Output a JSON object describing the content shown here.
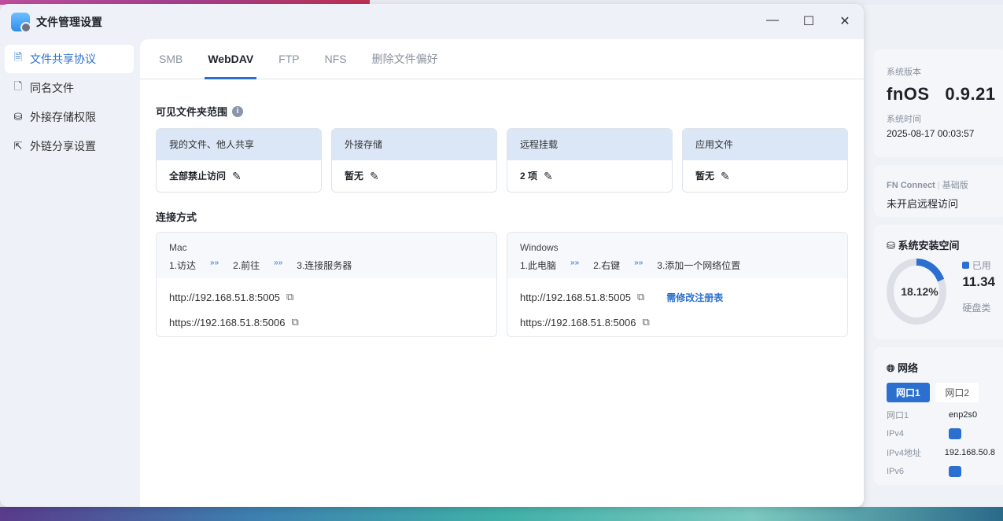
{
  "window": {
    "title": "文件管理设置",
    "minimize": "—",
    "maximize": "☐",
    "close": "✕"
  },
  "sidebar": {
    "items": [
      {
        "label": "文件共享协议",
        "icon": "document-icon"
      },
      {
        "label": "同名文件",
        "icon": "file-icon"
      },
      {
        "label": "外接存储权限",
        "icon": "drive-icon"
      },
      {
        "label": "外链分享设置",
        "icon": "share-icon"
      }
    ]
  },
  "tabs": [
    "SMB",
    "WebDAV",
    "FTP",
    "NFS",
    "删除文件偏好"
  ],
  "active_tab": "WebDAV",
  "scope": {
    "title": "可见文件夹范围",
    "cards": [
      {
        "head": "我的文件、他人共享",
        "value": "全部禁止访问"
      },
      {
        "head": "外接存储",
        "value": "暂无"
      },
      {
        "head": "远程挂载",
        "value": "2 项"
      },
      {
        "head": "应用文件",
        "value": "暂无"
      }
    ]
  },
  "connection": {
    "title": "连接方式",
    "mac": {
      "os": "Mac",
      "steps": [
        "1.访达",
        "2.前往",
        "3.连接服务器"
      ],
      "http": "http://192.168.51.8:5005",
      "https": "https://192.168.51.8:5006"
    },
    "windows": {
      "os": "Windows",
      "steps": [
        "1.此电脑",
        "2.右键",
        "3.添加一个网络位置"
      ],
      "http": "http://192.168.51.8:5005",
      "https": "https://192.168.51.8:5006",
      "registry_link": "需修改注册表"
    },
    "arrow": "»»"
  },
  "widgets": {
    "version": {
      "label": "系统版本",
      "value": "fnOS   0.9.21",
      "time_label": "系统时间",
      "time": "2025-08-17 00:03:57"
    },
    "connect": {
      "name": "FN Connect",
      "tier": "基础版",
      "status": "未开启远程访问"
    },
    "storage": {
      "title": "系统安装空间",
      "percent": "18.12%",
      "percent_value": 18.12,
      "used_label": "已用",
      "used": "11.34",
      "disk_label": "硬盘类"
    },
    "network": {
      "title": "网络",
      "tabs": [
        "网口1",
        "网口2"
      ],
      "rows": [
        {
          "k": "网口1",
          "v": "enp2s0"
        },
        {
          "k": "IPv4",
          "v": ""
        },
        {
          "k": "IPv4地址",
          "v": "192.168.50.8"
        },
        {
          "k": "IPv6",
          "v": ""
        }
      ]
    }
  }
}
